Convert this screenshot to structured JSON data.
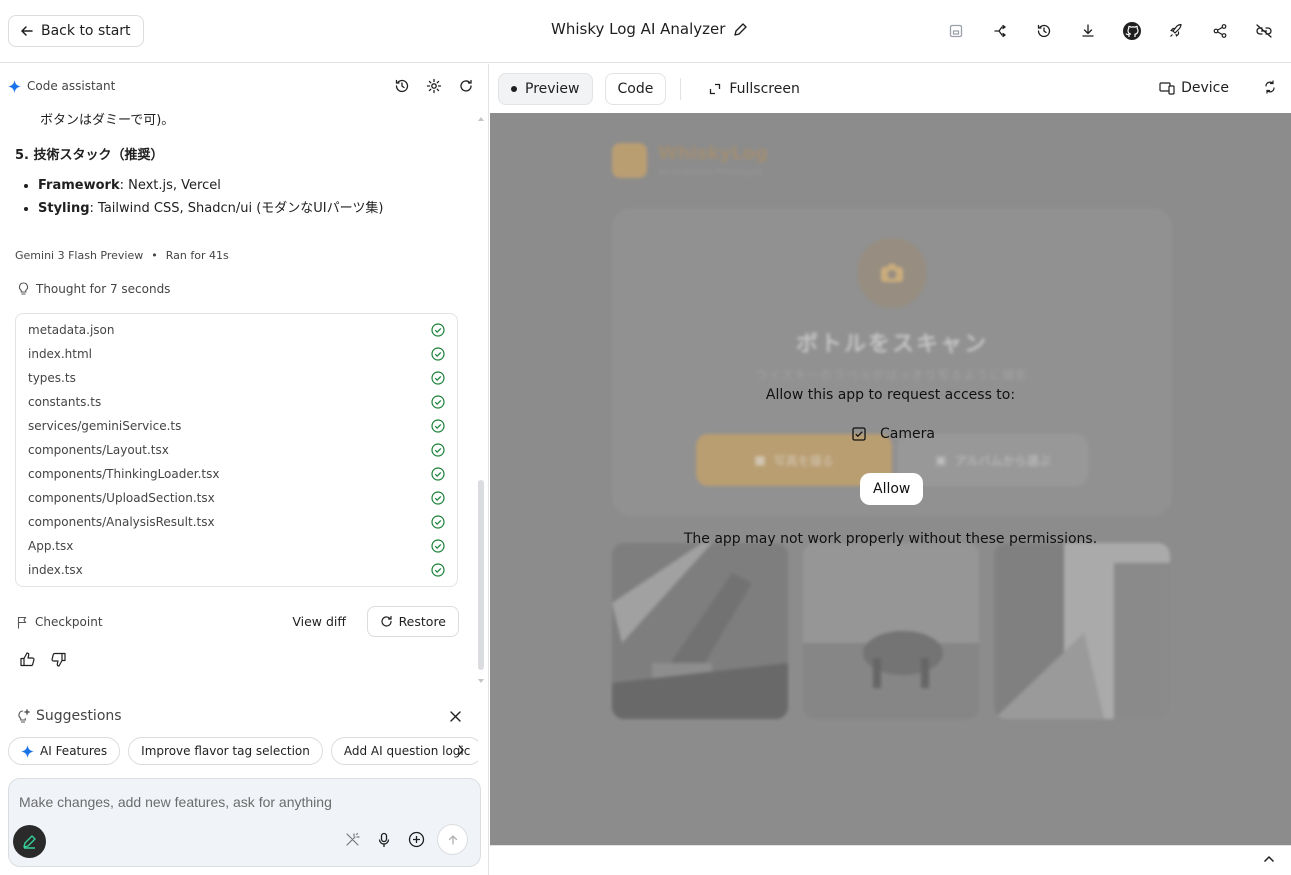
{
  "header": {
    "back_label": "Back to start",
    "title": "Whisky Log AI Analyzer",
    "icons": [
      "save-icon",
      "fork-icon",
      "history-icon",
      "download-icon",
      "github-icon",
      "deploy-rocket-icon",
      "share-icon",
      "link-off-icon"
    ]
  },
  "assistant": {
    "title": "Code assistant",
    "message": {
      "line_prev": "ボタンはダミーで可)。",
      "section_title": "5. 技術スタック（推奨）",
      "bullets": [
        {
          "label": "Framework",
          "text": ": Next.js, Vercel"
        },
        {
          "label": "Styling",
          "text": ": Tailwind CSS, Shadcn/ui (モダンなUIパーツ集)"
        }
      ]
    },
    "model": "Gemini 3 Flash Preview",
    "runtime": "Ran for 41s",
    "thought": "Thought for 7 seconds",
    "files": [
      "metadata.json",
      "index.html",
      "types.ts",
      "constants.ts",
      "services/geminiService.ts",
      "components/Layout.tsx",
      "components/ThinkingLoader.tsx",
      "components/UploadSection.tsx",
      "components/AnalysisResult.tsx",
      "App.tsx",
      "index.tsx"
    ],
    "checkpoint_label": "Checkpoint",
    "view_diff_label": "View diff",
    "restore_label": "Restore"
  },
  "suggestions": {
    "title": "Suggestions",
    "chips": [
      "AI Features",
      "Improve flavor tag selection",
      "Add AI question logic"
    ]
  },
  "input": {
    "placeholder": "Make changes, add new features, ask for anything"
  },
  "preview_toolbar": {
    "tabs": [
      "Preview",
      "Code"
    ],
    "fullscreen_label": "Fullscreen",
    "device_label": "Device"
  },
  "preview_app": {
    "brand": "WhiskyLog",
    "brand_sub": "AI Analysis Prototype",
    "scan_title": "ボトルをスキャン",
    "scan_sub": "ウイスキーのラベルがはっきり写るように撮影",
    "take_photo": "写真を撮る",
    "from_album": "アルバムから選ぶ"
  },
  "permission": {
    "prompt": "Allow this app to request access to:",
    "camera_label": "Camera",
    "camera_checked": true,
    "allow_label": "Allow",
    "warning": "The app may not work properly without these permissions."
  }
}
